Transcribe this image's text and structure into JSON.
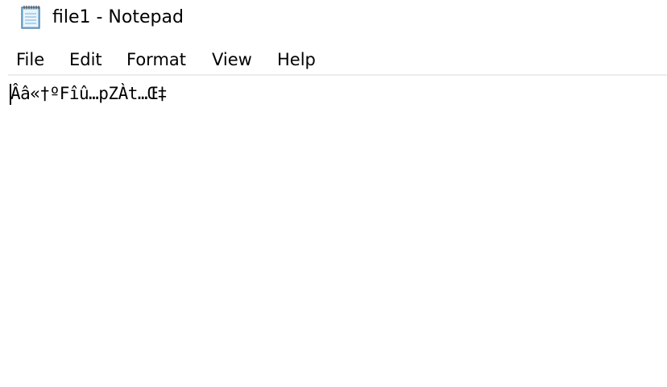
{
  "window": {
    "title": "file1 - Notepad",
    "icon": "notepad-icon"
  },
  "menu": {
    "items": [
      {
        "label": "File"
      },
      {
        "label": "Edit"
      },
      {
        "label": "Format"
      },
      {
        "label": "View"
      },
      {
        "label": "Help"
      }
    ]
  },
  "editor": {
    "content": "Ââ«†ºFîû…pZÀt…Œ‡"
  }
}
